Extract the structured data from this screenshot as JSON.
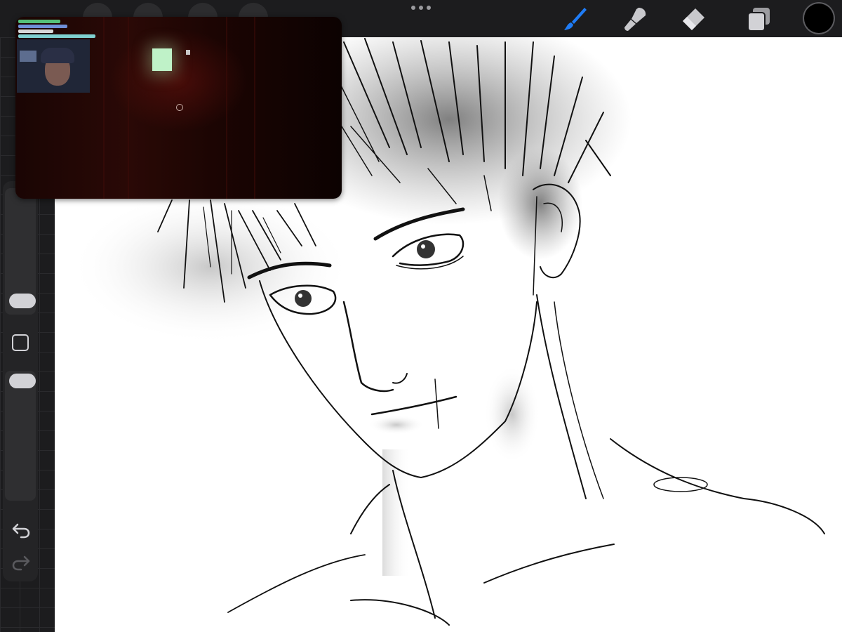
{
  "toolbar": {
    "left_tools": [
      "gallery-moon-icon",
      "adjustments-icon",
      "selection-icon",
      "transform-icon"
    ],
    "more_icon": "more-dots-icon",
    "right_tools": {
      "brush": {
        "icon": "brush-icon",
        "active": true,
        "color": "#1f7cf6"
      },
      "smudge": {
        "icon": "smudge-icon",
        "active": false
      },
      "eraser": {
        "icon": "eraser-icon",
        "active": false
      },
      "layers": {
        "icon": "layers-icon",
        "active": false
      }
    },
    "current_color": "#000000"
  },
  "sidebar": {
    "brush_size_slider": {
      "level": 0.2
    },
    "modify_button_icon": "square-icon",
    "opacity_slider": {
      "level": 0.9
    },
    "undo_icon": "undo-icon",
    "redo_icon": "redo-icon"
  },
  "canvas": {
    "background": "#ffffff",
    "artwork": "pencil-sketch-portrait"
  },
  "pip_video": {
    "webcam_present": true,
    "scene": "dark-red-room-with-glowing-screen"
  },
  "colors": {
    "ui_background": "#1c1c1e",
    "accent": "#1f7cf6",
    "icon_light": "#d2d2d6"
  }
}
